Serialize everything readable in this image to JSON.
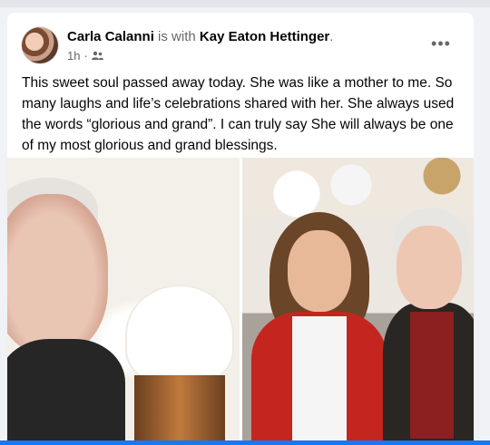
{
  "post": {
    "author": "Carla Calanni",
    "with_text": " is with ",
    "tagged": "Kay Eaton Hettinger",
    "tagged_suffix": ".",
    "time": "1h",
    "audience_icon": "friends-icon",
    "more_icon": "more-options-icon",
    "more_label": "•••",
    "text": "This sweet soul passed away today.  She was like a mother to me. So many laughs and life’s celebrations shared with her. She always used the words “glorious and grand”. I can truly say She will always be one of my most glorious and grand blessings."
  },
  "colors": {
    "background": "#f0f2f5",
    "card": "#ffffff",
    "primary_text": "#050505",
    "secondary_text": "#65676b",
    "accent": "#1877f2"
  }
}
